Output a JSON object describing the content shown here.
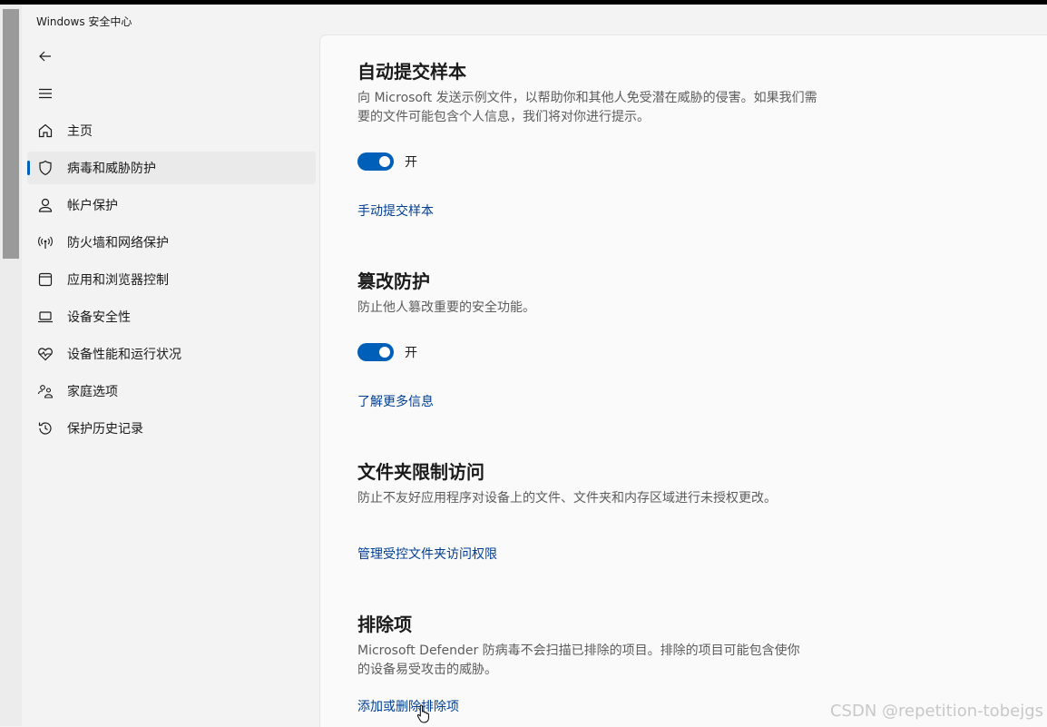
{
  "window": {
    "title": "Windows 安全中心"
  },
  "nav": {
    "back_icon": "back-arrow-icon",
    "menu_icon": "hamburger-menu-icon",
    "items": [
      {
        "label": "主页",
        "icon": "home-icon"
      },
      {
        "label": "病毒和威胁防护",
        "icon": "shield-icon",
        "active": true
      },
      {
        "label": "帐户保护",
        "icon": "person-icon"
      },
      {
        "label": "防火墙和网络保护",
        "icon": "wireless-icon"
      },
      {
        "label": "应用和浏览器控制",
        "icon": "app-window-icon"
      },
      {
        "label": "设备安全性",
        "icon": "laptop-icon"
      },
      {
        "label": "设备性能和运行状况",
        "icon": "heart-pulse-icon"
      },
      {
        "label": "家庭选项",
        "icon": "family-icon"
      },
      {
        "label": "保护历史记录",
        "icon": "history-icon"
      }
    ]
  },
  "sections": {
    "sample": {
      "title": "自动提交样本",
      "desc": "向 Microsoft 发送示例文件，以帮助你和其他人免受潜在威胁的侵害。如果我们需要的文件可能包含个人信息，我们将对你进行提示。",
      "toggle_label": "开",
      "toggle_on": true,
      "link": "手动提交样本"
    },
    "tamper": {
      "title": "篡改防护",
      "desc": "防止他人篡改重要的安全功能。",
      "toggle_label": "开",
      "toggle_on": true,
      "link": "了解更多信息"
    },
    "folder": {
      "title": "文件夹限制访问",
      "desc": "防止不友好应用程序对设备上的文件、文件夹和内存区域进行未授权更改。",
      "link": "管理受控文件夹访问权限"
    },
    "exclusions": {
      "title": "排除项",
      "desc": "Microsoft Defender 防病毒不会扫描已排除的项目。排除的项目可能包含使你的设备易受攻击的威胁。",
      "link": "添加或删除排除项"
    }
  },
  "watermark": "CSDN @repetition-tobejgs",
  "colors": {
    "accent": "#005fb8",
    "link": "#003e92"
  }
}
